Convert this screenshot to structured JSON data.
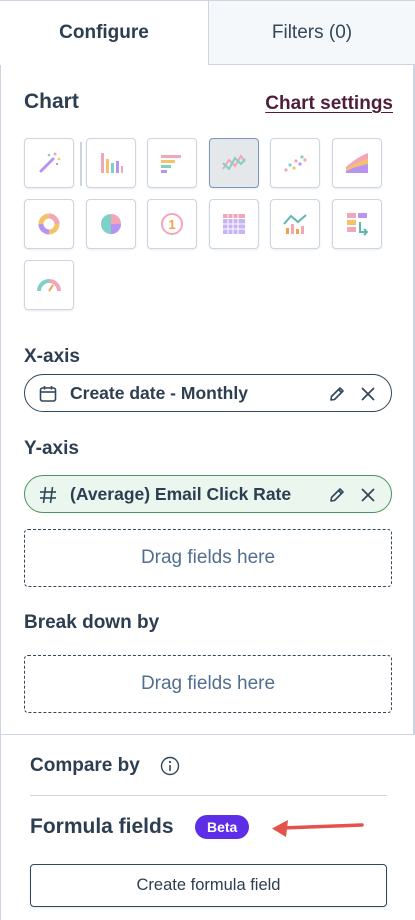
{
  "tabs": {
    "configure": "Configure",
    "filters": "Filters (0)"
  },
  "chart": {
    "title": "Chart",
    "settings_link": "Chart settings",
    "types": [
      {
        "icon": "magic-wand-icon",
        "selected": false
      },
      {
        "icon": "bar-chart-icon",
        "selected": false
      },
      {
        "icon": "horizontal-bar-chart-icon",
        "selected": false
      },
      {
        "icon": "line-chart-icon",
        "selected": true
      },
      {
        "icon": "scatter-chart-icon",
        "selected": false
      },
      {
        "icon": "area-chart-icon",
        "selected": false
      },
      {
        "icon": "donut-chart-icon",
        "selected": false
      },
      {
        "icon": "pie-chart-icon",
        "selected": false
      },
      {
        "icon": "single-value-icon",
        "selected": false
      },
      {
        "icon": "pivot-table-icon",
        "selected": false
      },
      {
        "icon": "combo-chart-icon",
        "selected": false
      },
      {
        "icon": "summary-table-icon",
        "selected": false
      },
      {
        "icon": "gauge-chart-icon",
        "selected": false
      }
    ]
  },
  "x_axis": {
    "label": "X-axis",
    "field": "Create date - Monthly"
  },
  "y_axis": {
    "label": "Y-axis",
    "field": "(Average) Email Click Rate",
    "dropzone": "Drag fields here"
  },
  "breakdown": {
    "label": "Break down by",
    "dropzone": "Drag fields here"
  },
  "compare": {
    "label": "Compare by"
  },
  "formula": {
    "label": "Formula fields",
    "badge": "Beta",
    "button": "Create formula field"
  },
  "colors": {
    "selected_bg": "#e5e8eb",
    "beta": "#5e2ee6",
    "y_pill_border": "#4a9560",
    "arrow": "#e5524a"
  }
}
